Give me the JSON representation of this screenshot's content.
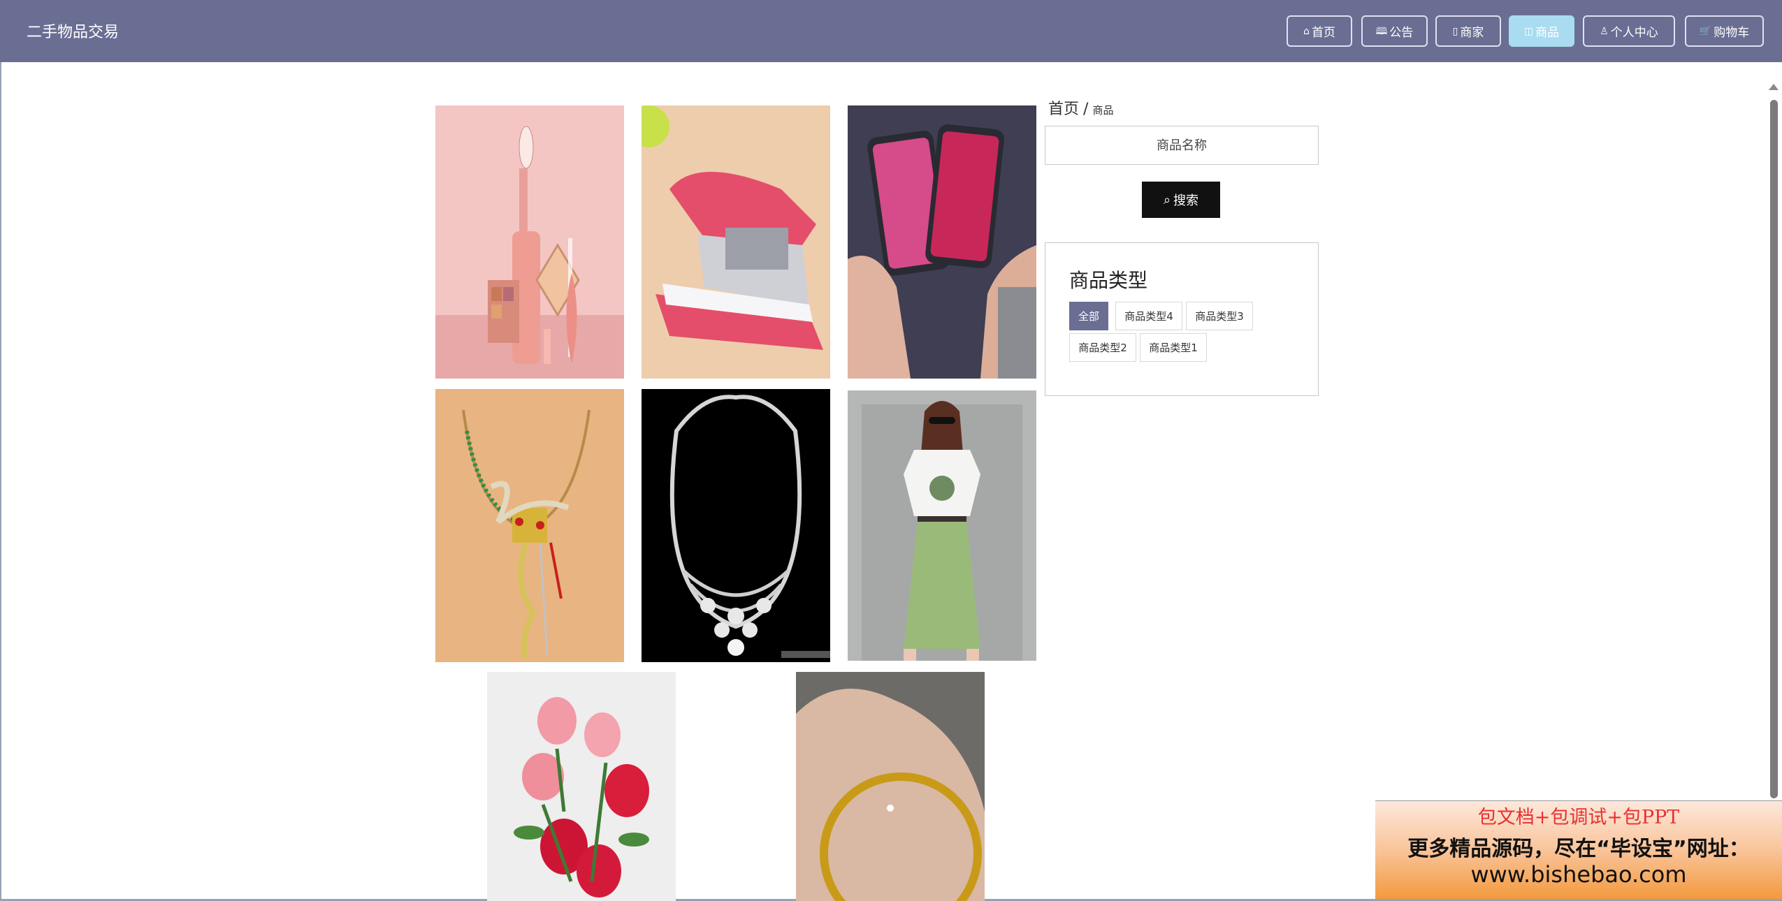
{
  "header": {
    "brand": "二手物品交易",
    "nav": [
      {
        "label": "首页",
        "icon": "home-icon",
        "active": false
      },
      {
        "label": "公告",
        "icon": "book-icon",
        "active": false
      },
      {
        "label": "商家",
        "icon": "bookmark-icon",
        "active": false
      },
      {
        "label": "商品",
        "icon": "product-icon",
        "active": true
      },
      {
        "label": "个人中心",
        "icon": "user-icon",
        "active": false
      },
      {
        "label": "购物车",
        "icon": "cart-icon",
        "active": false
      }
    ]
  },
  "breadcrumb": {
    "home": "首页",
    "separator": "/",
    "current": "商品"
  },
  "search": {
    "placeholder": "商品名称",
    "button_label": "搜索"
  },
  "categories": {
    "title": "商品类型",
    "items": [
      {
        "label": "全部",
        "active": true
      },
      {
        "label": "商品类型4",
        "active": false
      },
      {
        "label": "商品类型3",
        "active": false
      },
      {
        "label": "商品类型2",
        "active": false
      },
      {
        "label": "商品类型1",
        "active": false
      }
    ]
  },
  "products": [
    {
      "subject": "cosmetics"
    },
    {
      "subject": "stapler"
    },
    {
      "subject": "smartphones"
    },
    {
      "subject": "jeweled-necklace"
    },
    {
      "subject": "diamond-necklace"
    },
    {
      "subject": "tshirt-skirt-outfit"
    },
    {
      "subject": "pink-red-roses"
    },
    {
      "subject": "gold-bangle"
    }
  ],
  "ad": {
    "line1": "包文档+包调试+包PPT",
    "line2": "更多精品源码，尽在“毕设宝”网址：",
    "line3": "www.bishebao.com"
  }
}
